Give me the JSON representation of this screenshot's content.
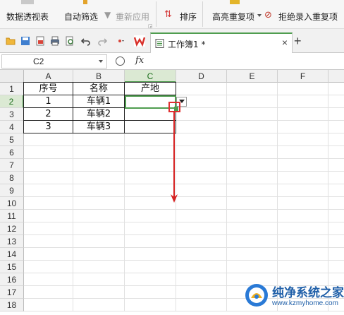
{
  "ribbon": {
    "pivot_label": "数据透视表",
    "autofilter_label": "自动筛选",
    "reapply_label": "重新应用",
    "sort_label": "排序",
    "highlight_dup_label": "高亮重复项",
    "reject_dup_label": "拒绝录入重复项"
  },
  "tabbar": {
    "doc_title": "工作簿1 *",
    "close_glyph": "×",
    "new_tab_glyph": "+"
  },
  "formula_bar": {
    "name_box": "C2",
    "fx": "fx",
    "formula": ""
  },
  "columns": [
    "A",
    "B",
    "C",
    "D",
    "E",
    "F"
  ],
  "active_column": "C",
  "active_row": "2",
  "rows": [
    "1",
    "2",
    "3",
    "4",
    "5",
    "6",
    "7",
    "8",
    "9",
    "10",
    "11",
    "12",
    "13",
    "14",
    "15",
    "16",
    "17",
    "18"
  ],
  "table": {
    "header": [
      "序号",
      "名称",
      "产地"
    ],
    "rows": [
      [
        "1",
        "车辆1",
        ""
      ],
      [
        "2",
        "车辆2",
        ""
      ],
      [
        "3",
        "车辆3",
        ""
      ]
    ]
  },
  "watermark": {
    "title": "纯净系统之家",
    "url": "www.kzmyhome.com"
  },
  "colors": {
    "accent_green": "#4f9d4f",
    "annotation_red": "#e03030",
    "watermark_blue": "#1f5fa8"
  }
}
